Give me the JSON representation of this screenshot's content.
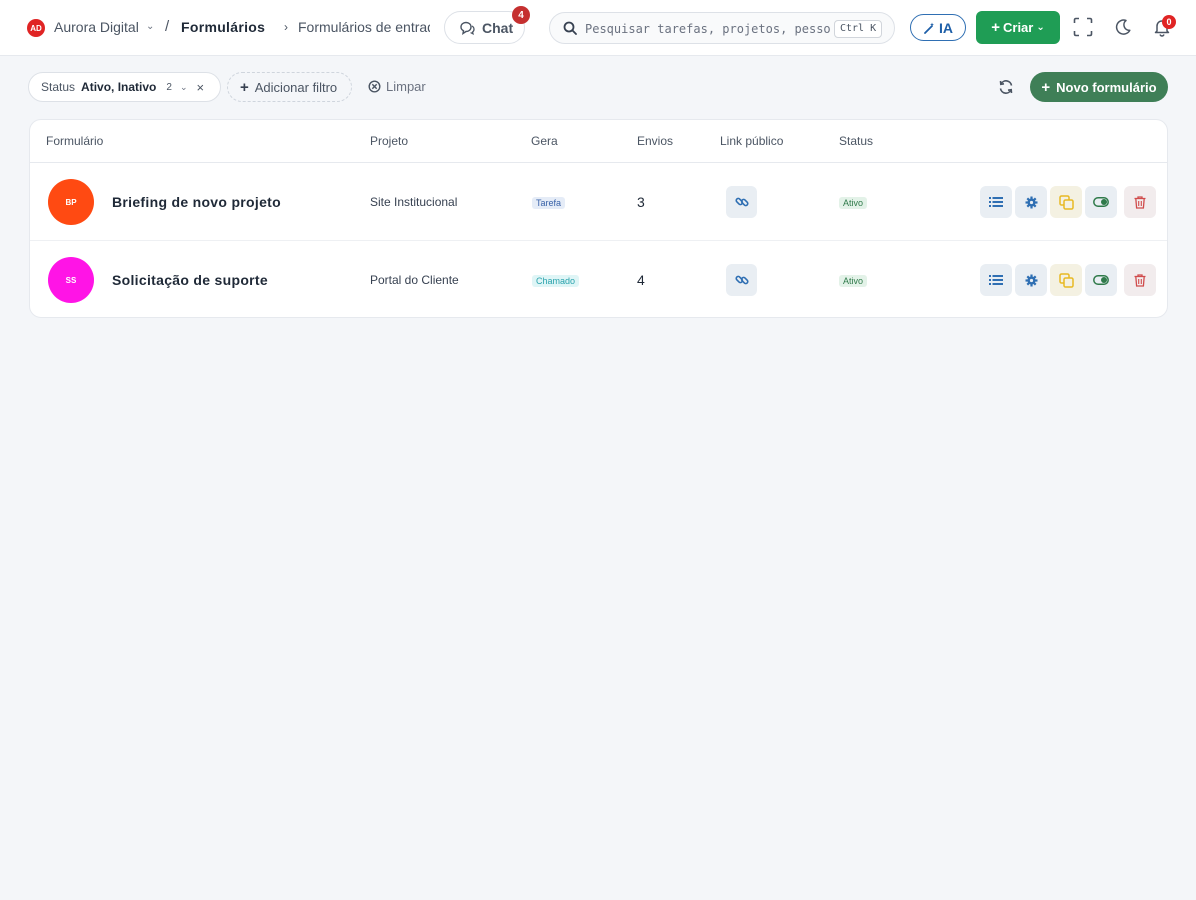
{
  "header": {
    "workspace_initials": "AD",
    "workspace_name": "Aurora Digital",
    "breadcrumb_sep": "/",
    "breadcrumb_current": "Formulários",
    "breadcrumb_arrow": "›",
    "breadcrumb_sub": "Formulários de entrada",
    "chat_label": "Chat",
    "chat_badge": "4",
    "search_placeholder": "Pesquisar tarefas, projetos, pessoas...",
    "search_shortcut": "Ctrl K",
    "ia_label": "IA",
    "create_label": "Criar",
    "notifications_count": "0"
  },
  "filters": {
    "status_key": "Status",
    "status_value": "Ativo, Inativo",
    "status_count": "2",
    "add_filter_label": "Adicionar filtro",
    "clear_label": "Limpar",
    "new_form_label": "Novo formulário"
  },
  "table": {
    "headers": {
      "form": "Formulário",
      "project": "Projeto",
      "generates": "Gera",
      "submissions": "Envios",
      "public_link": "Link público",
      "status": "Status"
    },
    "rows": [
      {
        "initials": "BP",
        "avatar_color": "#ff4a12",
        "name": "Briefing de novo projeto",
        "project": "Site Institucional",
        "generates": "Tarefa",
        "submissions": "3",
        "status": "Ativo"
      },
      {
        "initials": "SS",
        "avatar_color": "#ff14e6",
        "name": "Solicitação de suporte",
        "project": "Portal do Cliente",
        "generates": "Chamado",
        "submissions": "4",
        "status": "Ativo"
      }
    ]
  },
  "colors": {
    "primary_green": "#1f9d55",
    "new_button": "#3f7f57",
    "link_blue": "#2f6fb3",
    "tarefa_badge_bg": "#e5ecf7",
    "tarefa_badge_fg": "#3a63a8",
    "chamado_badge_bg": "#dff5f6",
    "chamado_badge_fg": "#2aa3ad",
    "status_active_fg": "#2f7a4a"
  },
  "icons": [
    "chat-icon",
    "search-icon",
    "magic-wand-icon",
    "plus-icon",
    "chevron-down-icon",
    "fullscreen-icon",
    "moon-icon",
    "bell-icon",
    "close-icon",
    "clear-icon",
    "refresh-icon",
    "link-icon",
    "list-icon",
    "gear-icon",
    "copy-icon",
    "toggle-icon",
    "trash-icon"
  ]
}
